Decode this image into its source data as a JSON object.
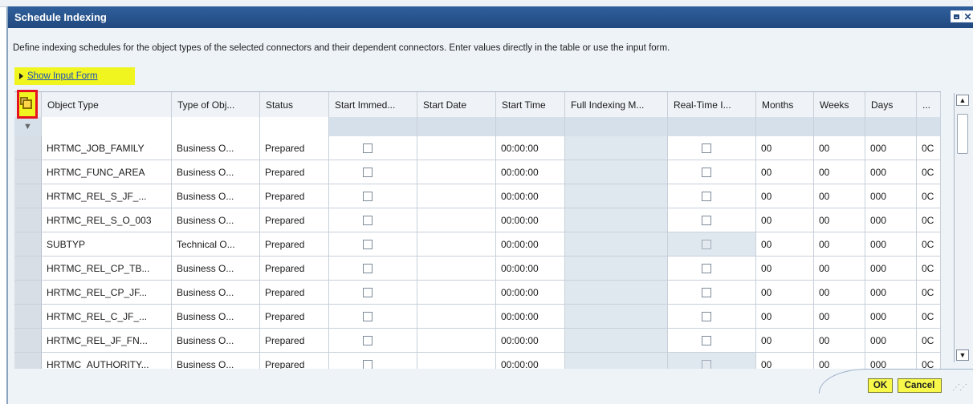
{
  "dialog": {
    "title": "Schedule Indexing",
    "description": "Define indexing schedules for the object types of the selected connectors and their dependent connectors. Enter values directly in the table or use the input form.",
    "show_input_form": "Show Input Form",
    "ok_label": "OK",
    "cancel_label": "Cancel"
  },
  "icons": {
    "maximize": "maximize-icon",
    "close": "close-icon",
    "select_all": "select-all-icon",
    "filter": "filter-icon",
    "expand": "triangle-right-icon",
    "scroll_up": "scroll-up-icon",
    "scroll_down": "scroll-down-icon"
  },
  "colors": {
    "title_bar": "#21497f",
    "highlight": "#f0f51f",
    "red_marker": "#e4151f",
    "link": "#1c4fb8"
  },
  "table": {
    "columns": [
      "Object Type",
      "Type of Obj...",
      "Status",
      "Start Immed...",
      "Start Date",
      "Start Time",
      "Full Indexing M...",
      "Real-Time I...",
      "Months",
      "Weeks",
      "Days",
      "..."
    ],
    "rows": [
      {
        "object_type": "HRTMC_JOB_FAMILY",
        "type": "Business O...",
        "status": "Prepared",
        "start_time": "00:00:00",
        "months": "00",
        "weeks": "00",
        "days": "000",
        "more": "0C",
        "realtime_enabled": true
      },
      {
        "object_type": "HRTMC_FUNC_AREA",
        "type": "Business O...",
        "status": "Prepared",
        "start_time": "00:00:00",
        "months": "00",
        "weeks": "00",
        "days": "000",
        "more": "0C",
        "realtime_enabled": true
      },
      {
        "object_type": "HRTMC_REL_S_JF_...",
        "type": "Business O...",
        "status": "Prepared",
        "start_time": "00:00:00",
        "months": "00",
        "weeks": "00",
        "days": "000",
        "more": "0C",
        "realtime_enabled": true
      },
      {
        "object_type": "HRTMC_REL_S_O_003",
        "type": "Business O...",
        "status": "Prepared",
        "start_time": "00:00:00",
        "months": "00",
        "weeks": "00",
        "days": "000",
        "more": "0C",
        "realtime_enabled": true
      },
      {
        "object_type": "SUBTYP",
        "type": "Technical O...",
        "status": "Prepared",
        "start_time": "00:00:00",
        "months": "00",
        "weeks": "00",
        "days": "000",
        "more": "0C",
        "realtime_enabled": false
      },
      {
        "object_type": "HRTMC_REL_CP_TB...",
        "type": "Business O...",
        "status": "Prepared",
        "start_time": "00:00:00",
        "months": "00",
        "weeks": "00",
        "days": "000",
        "more": "0C",
        "realtime_enabled": true
      },
      {
        "object_type": "HRTMC_REL_CP_JF...",
        "type": "Business O...",
        "status": "Prepared",
        "start_time": "00:00:00",
        "months": "00",
        "weeks": "00",
        "days": "000",
        "more": "0C",
        "realtime_enabled": true
      },
      {
        "object_type": "HRTMC_REL_C_JF_...",
        "type": "Business O...",
        "status": "Prepared",
        "start_time": "00:00:00",
        "months": "00",
        "weeks": "00",
        "days": "000",
        "more": "0C",
        "realtime_enabled": true
      },
      {
        "object_type": "HRTMC_REL_JF_FN...",
        "type": "Business O...",
        "status": "Prepared",
        "start_time": "00:00:00",
        "months": "00",
        "weeks": "00",
        "days": "000",
        "more": "0C",
        "realtime_enabled": true
      },
      {
        "object_type": "HRTMC_AUTHORITY...",
        "type": "Business O...",
        "status": "Prepared",
        "start_time": "00:00:00",
        "months": "00",
        "weeks": "00",
        "days": "000",
        "more": "0C",
        "realtime_enabled": false
      }
    ]
  }
}
